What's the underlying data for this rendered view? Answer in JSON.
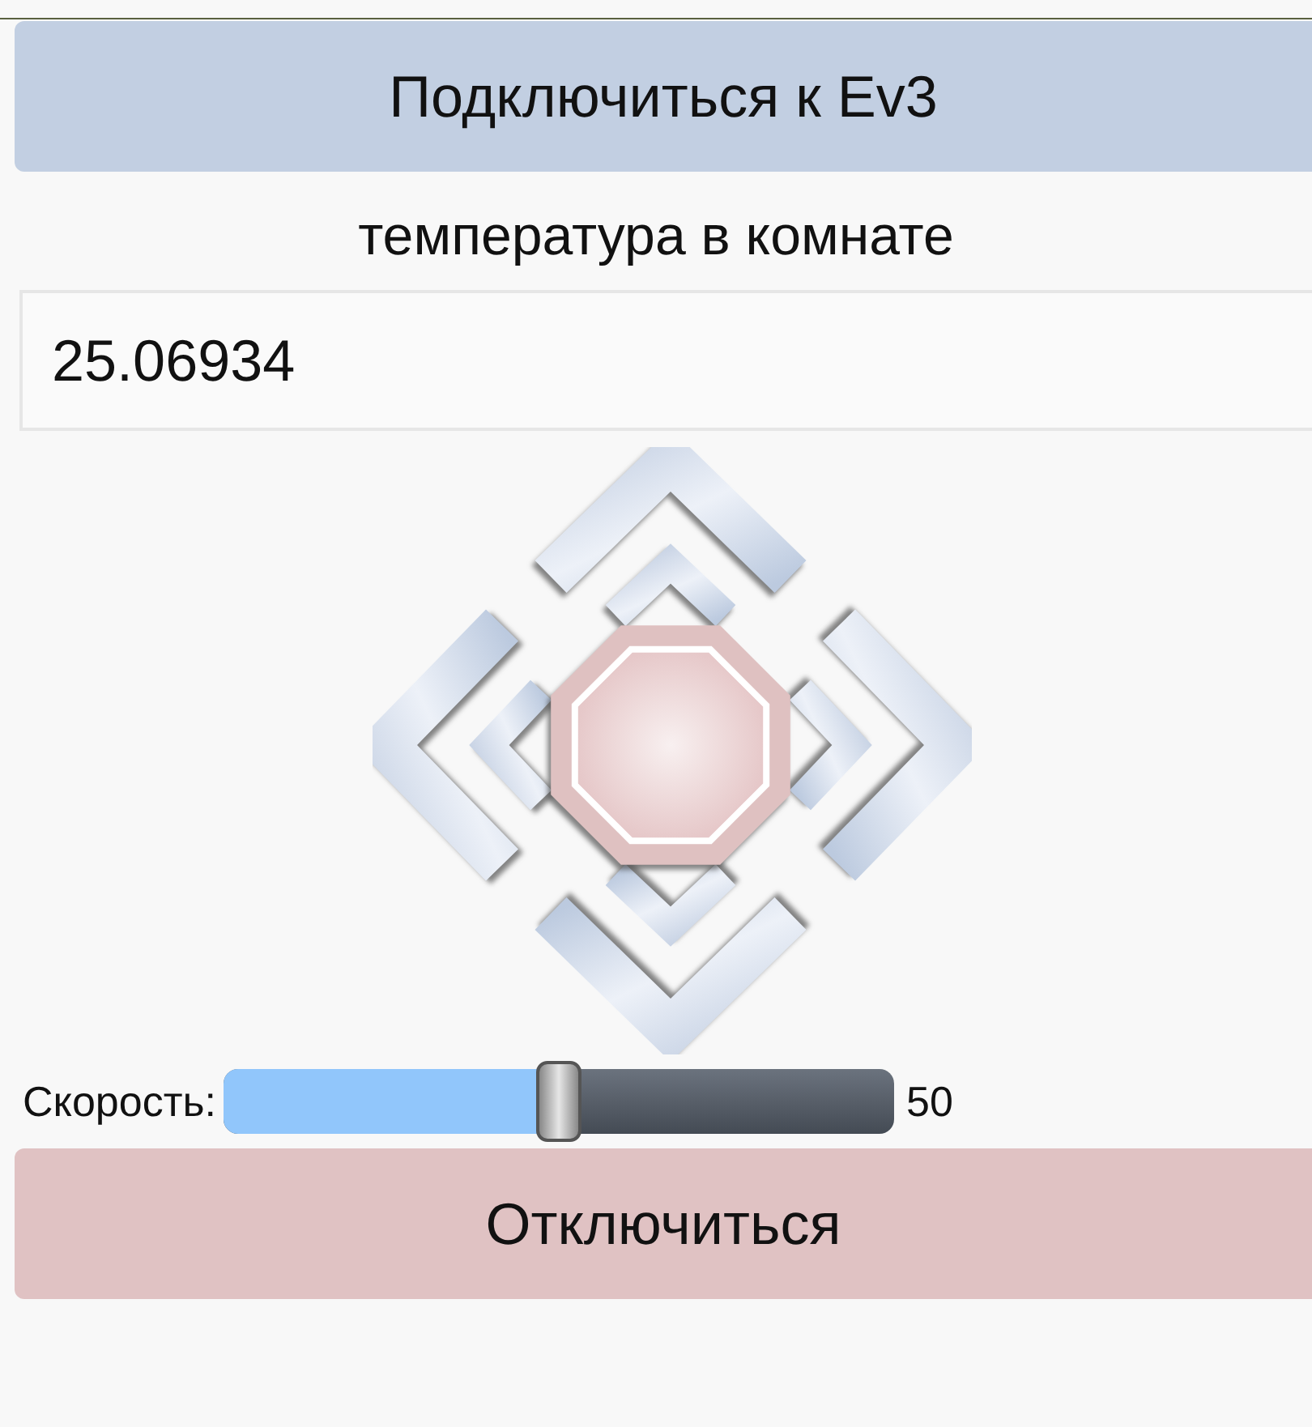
{
  "connect_button": {
    "label": "Подключиться к Ev3"
  },
  "temperature": {
    "label": "температура в комнате",
    "value": "25.06934"
  },
  "speed": {
    "label": "Скорость:",
    "level": 0.5,
    "reading": "50"
  },
  "disconnect_button": {
    "label": "Отключиться"
  }
}
